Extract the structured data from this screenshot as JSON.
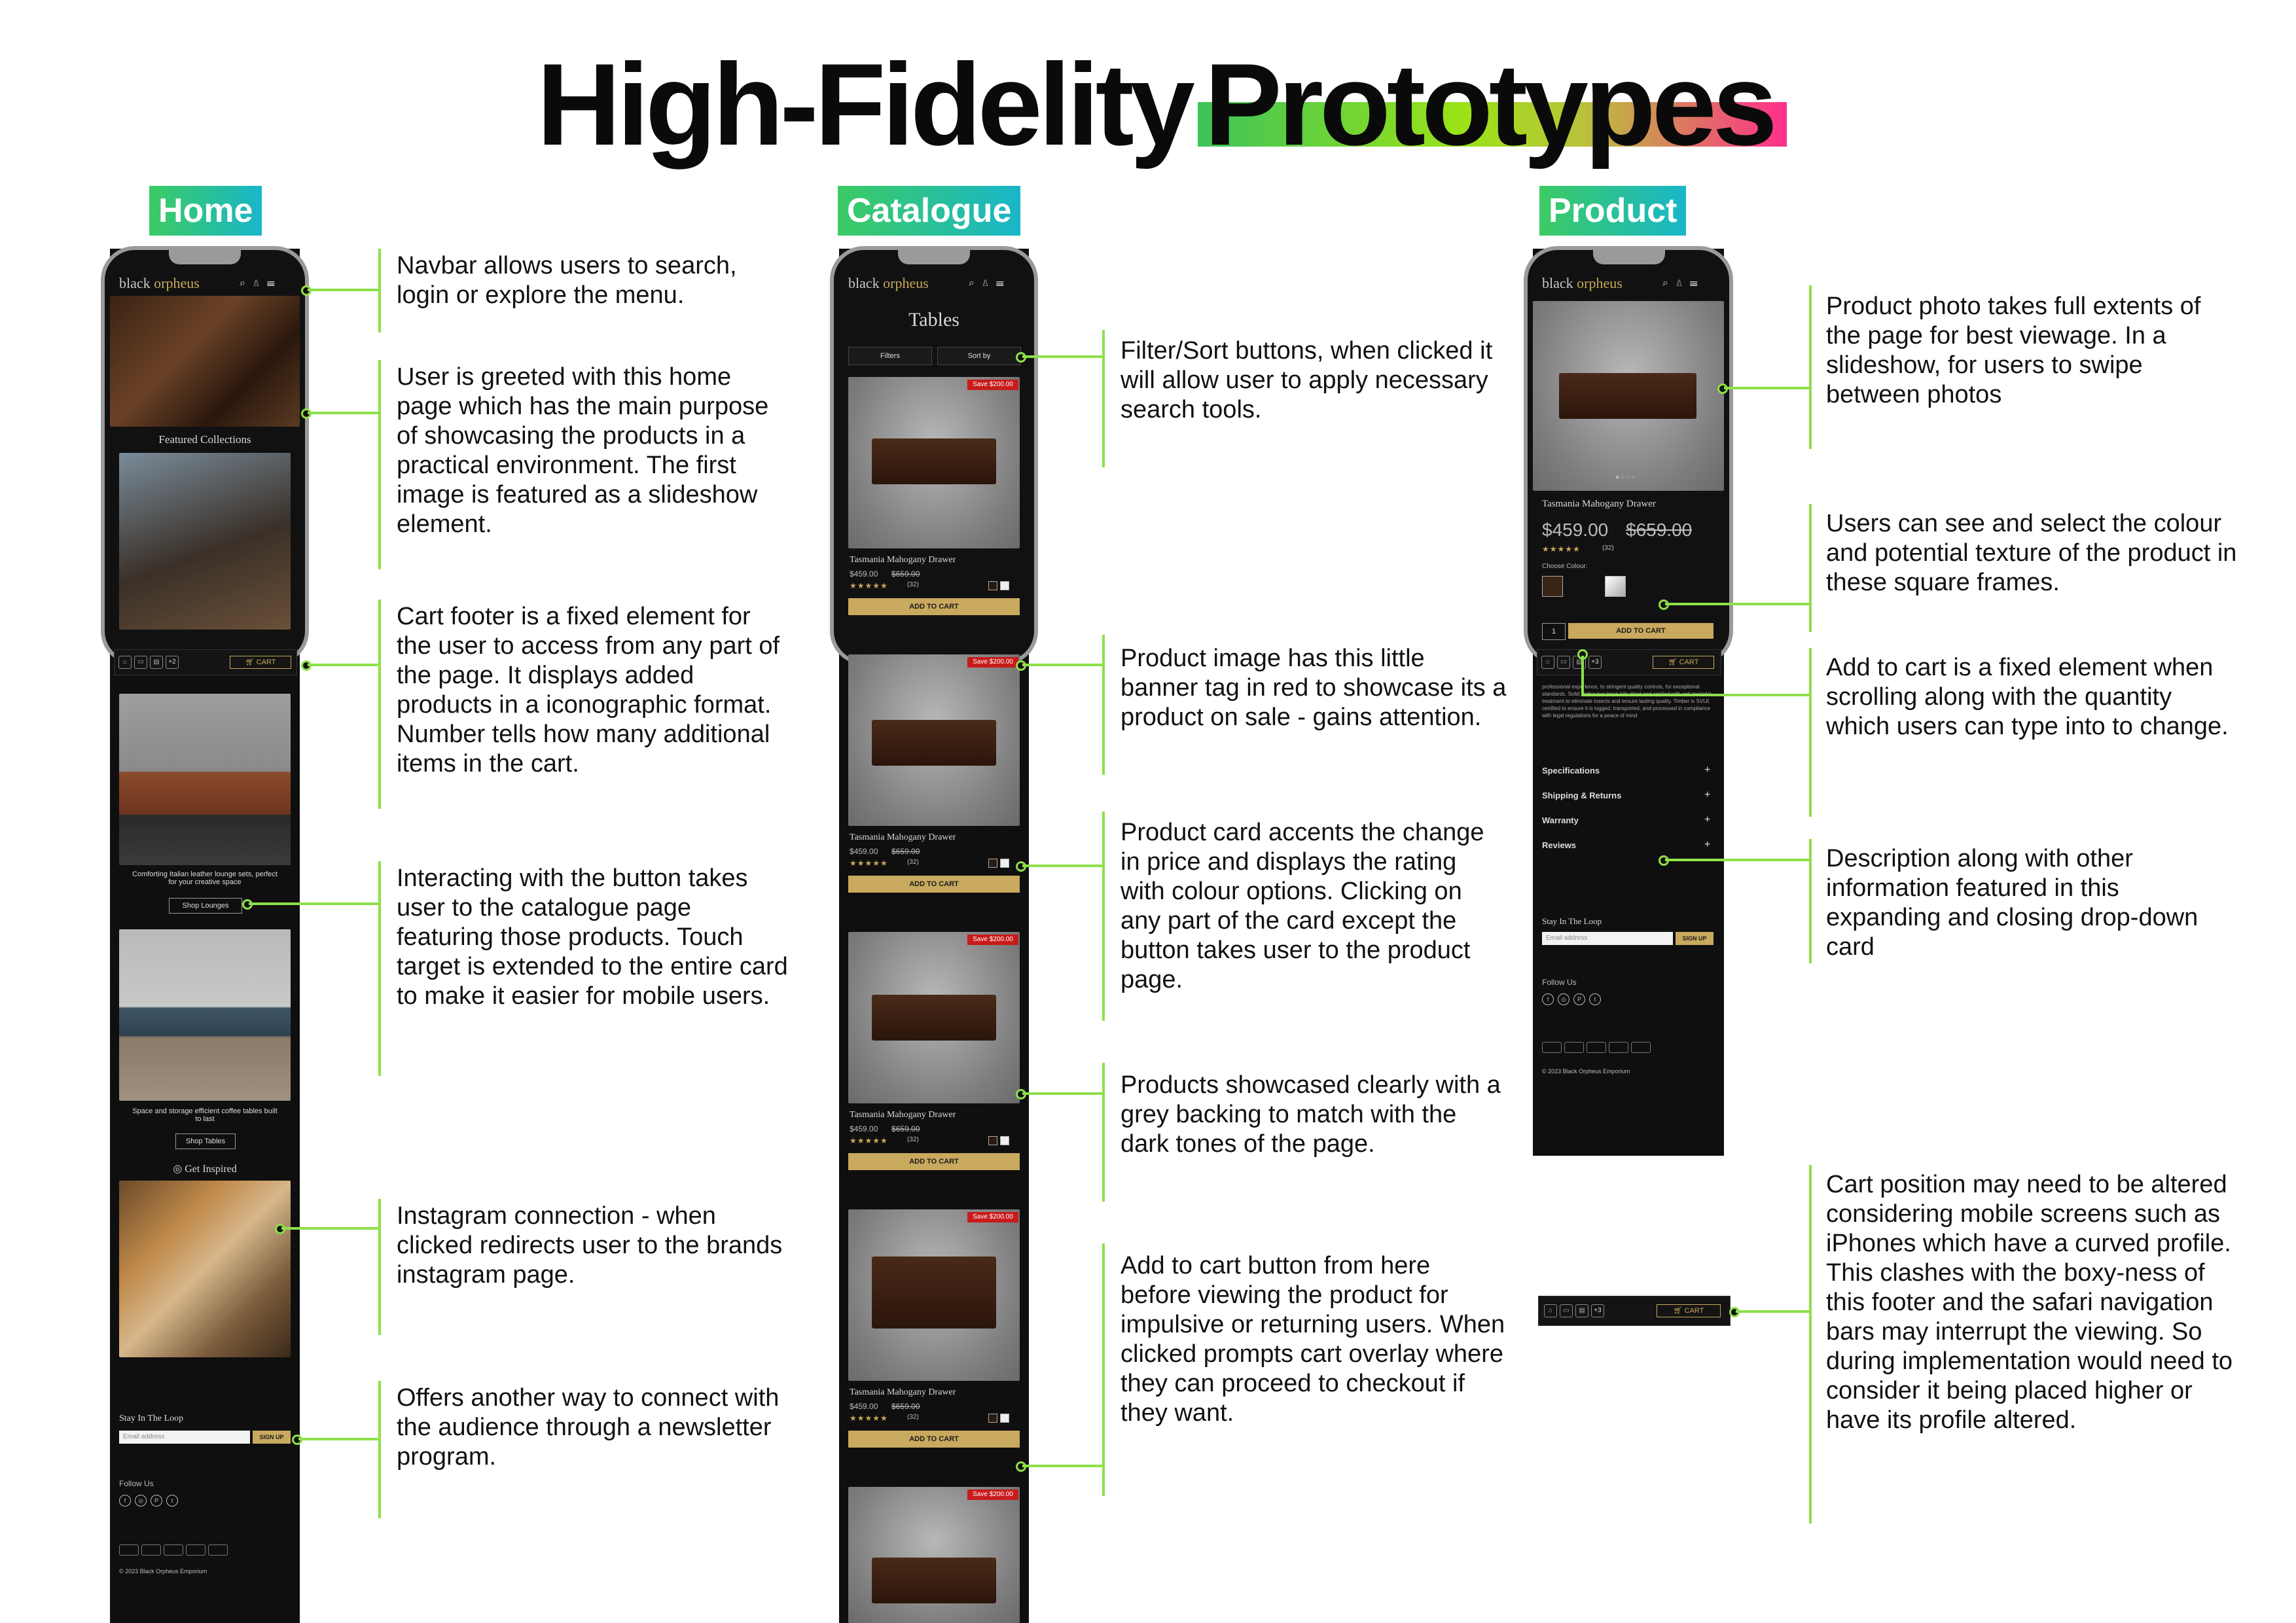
{
  "title": {
    "part1": "High-Fidelity",
    "part2": "Prototypes"
  },
  "sections": {
    "home": "Home",
    "catalogue": "Catalogue",
    "product": "Product"
  },
  "brand": {
    "word1": "black",
    "word2": "orpheus"
  },
  "home": {
    "featured": "Featured Collections",
    "cart_label": "CART",
    "cart_count": "+2",
    "lounge_caption": "Comforting Italian leather lounge sets, perfect for your creative space",
    "lounge_button": "Shop Lounges",
    "tables_caption": "Space and storage efficient coffee tables built to last",
    "tables_button": "Shop Tables",
    "instagram": "Get Inspired",
    "newsletter_title": "Stay In The Loop",
    "email_placeholder": "Email address",
    "signup": "SIGN UP",
    "follow": "Follow Us",
    "copyright": "© 2023 Black Orpheus Emporium"
  },
  "catalogue": {
    "heading": "Tables",
    "filters": "Filters",
    "sort": "Sort by",
    "cards": [
      {
        "sale": "Save $200.00",
        "name": "Tasmania Mahogany Drawer",
        "price": "$459.00",
        "old": "$659.00",
        "stars": "★★★★★",
        "reviews": "(32)",
        "button": "ADD TO CART"
      },
      {
        "sale": "Save $200.00",
        "name": "Tasmania Mahogany Drawer",
        "price": "$459.00",
        "old": "$659.00",
        "stars": "★★★★★",
        "reviews": "(32)",
        "button": "ADD TO CART"
      },
      {
        "sale": "Save $200.00",
        "name": "Tasmania Mahogany Drawer",
        "price": "$459.00",
        "old": "$659.00",
        "stars": "★★★★★",
        "reviews": "(32)",
        "button": "ADD TO CART"
      },
      {
        "sale": "Save $200.00",
        "name": "Tasmania Mahogany Drawer",
        "price": "$459.00",
        "old": "$659.00",
        "stars": "★★★★★",
        "reviews": "(32)",
        "button": "ADD TO CART"
      },
      {
        "sale": "Save $200.00"
      }
    ]
  },
  "product": {
    "name": "Tasmania Mahogany Drawer",
    "price": "$459.00",
    "old": "$659.00",
    "stars": "★★★★★",
    "reviews": "(32)",
    "choose": "Choose Colour:",
    "qty": "1",
    "add": "ADD TO CART",
    "cart_label": "CART",
    "cart_count": "+3",
    "desc": "professional experience, to stringent quality controls, for exceptional standards. Solid timber has been kiln-dried and applied with anti-toxicidal treatment to eliminate insects and ensure lasting quality. Timber is SVLK certified to ensure it is logged, transported, and processed in compliance with legal regulations for a peace of mind",
    "accordions": [
      "Specifications",
      "Shipping & Returns",
      "Warranty",
      "Reviews"
    ],
    "newsletter_title": "Stay In The Loop",
    "email_placeholder": "Email address",
    "signup": "SIGN UP",
    "follow": "Follow Us",
    "copyright": "© 2023 Black Orpheus Emporium",
    "alt_cart_label": "CART",
    "alt_cart_count": "+3"
  },
  "annotations": {
    "home": [
      "Navbar allows users to search, login or explore the menu.",
      "User is greeted with this home page which has the main purpose of showcasing the products in a practical environment. The first image is featured as a slideshow element.",
      "Cart footer is a fixed element for the user to access from any part of the page. It displays added products in a iconographic format. Number tells how many additional items in the cart.",
      "Interacting with the button takes user to the catalogue page featuring those products. Touch target is extended to the entire card to make it easier for mobile users.",
      "Instagram connection - when clicked redirects user to the brands instagram page.",
      "Offers another way to connect with the audience through a newsletter program."
    ],
    "catalogue": [
      "Filter/Sort buttons, when clicked it will allow user to apply necessary search tools.",
      "Product image has this little banner tag in red to showcase its a product on sale - gains attention.",
      "Product card accents the change in price and displays the rating with colour options. Clicking on any part of the card except the button takes user to the product page.",
      "Products showcased clearly with a grey backing to match with the dark tones of the page.",
      "Add to cart button from here before viewing the product for impulsive or returning users.  When clicked prompts cart overlay where they can proceed to checkout if they want."
    ],
    "product": [
      "Product photo takes full extents of the page for best viewage. In a slideshow, for users to swipe between photos",
      "Users can see and select the colour and potential texture of the product in these square frames.",
      "Add to cart is a fixed element when scrolling along with the quantity which users can type into to change.",
      "Description along with other information featured in this expanding and closing drop-down card",
      "Cart position may need to be altered considering mobile screens such as iPhones which have a curved profile. This clashes with the boxy-ness of this footer and the safari navigation bars may interrupt the viewing. So during implementation would need to consider it being placed higher or have its profile altered."
    ]
  },
  "colors": {
    "accent_green": "#8ee04a",
    "gold": "#c9a85a",
    "sale_red": "#c81b1b"
  }
}
